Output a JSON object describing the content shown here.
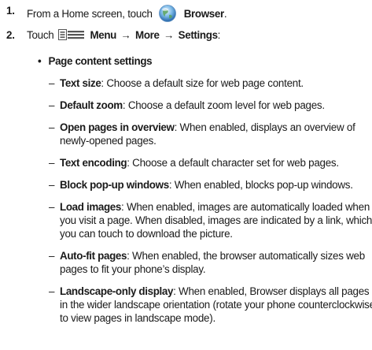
{
  "steps": [
    {
      "number": "1.",
      "pre": "From a Home screen, touch",
      "icon": "browser-icon",
      "bold": "Browser",
      "post": "."
    },
    {
      "number": "2.",
      "pre": "Touch",
      "icon": "menu-icon",
      "path": [
        "Menu",
        "More",
        "Settings"
      ],
      "arrow": "→",
      "post": ":"
    }
  ],
  "section": {
    "bullet": "•",
    "title": "Page content settings"
  },
  "dash": "–",
  "items": [
    {
      "term": "Text size",
      "lines": [
        ": Choose a default size for web page content."
      ]
    },
    {
      "term": "Default zoom",
      "lines": [
        ": Choose a default zoom level for web pages."
      ]
    },
    {
      "term": "Open pages in overview",
      "lines": [
        ": When enabled, displays an overview of",
        "newly-opened pages."
      ]
    },
    {
      "term": "Text encoding",
      "lines": [
        ": Choose a default character set for web pages."
      ]
    },
    {
      "term": "Block pop-up windows",
      "lines": [
        ": When enabled, blocks pop-up windows."
      ]
    },
    {
      "term": "Load images",
      "lines": [
        ": When enabled, images are automatically loaded when",
        "you visit a page. When disabled, images are indicated by a link, which",
        "you can touch to download the picture."
      ]
    },
    {
      "term": "Auto-fit pages",
      "lines": [
        ": When enabled, the browser automatically sizes web",
        "pages to fit your phone’s display."
      ]
    },
    {
      "term": "Landscape-only display",
      "lines": [
        ": When enabled, Browser displays all pages",
        "in the wider landscape orientation (rotate your phone counterclockwise",
        "to view pages in landscape mode)."
      ]
    }
  ]
}
